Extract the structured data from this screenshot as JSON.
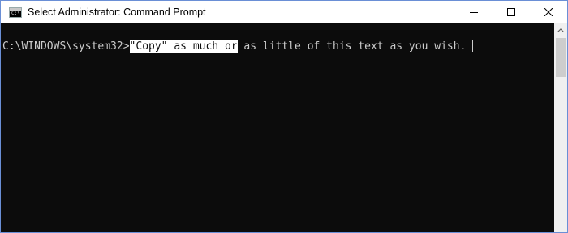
{
  "window": {
    "title": "Select Administrator: Command Prompt",
    "icon_text": "C:\\",
    "icon_name": "command-prompt-icon"
  },
  "controls": {
    "minimize": "minimize-icon",
    "maximize": "maximize-icon",
    "close": "close-icon"
  },
  "console": {
    "prompt": "C:\\WINDOWS\\system32>",
    "selected_text": "\"Copy\" as much or",
    "rest_text": " as little of this text as you wish. ",
    "foreground": "#cccccc",
    "background": "#0c0c0c",
    "selection_background": "#ffffff"
  }
}
